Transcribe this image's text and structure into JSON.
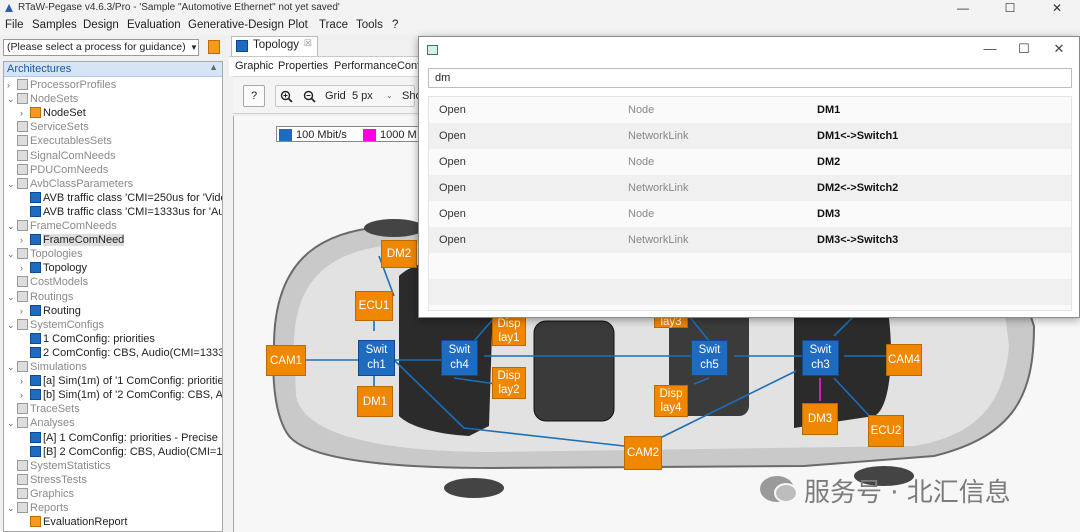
{
  "window": {
    "title": "RTaW-Pegase v4.6.3/Pro - 'Sample \"Automotive Ethernet\" not yet saved'",
    "controls": [
      "—",
      "☐",
      "✕"
    ]
  },
  "menu": [
    "File",
    "Samples",
    "Design",
    "Evaluation",
    "Generative-Design",
    "Plot",
    "Trace",
    "Tools",
    "?"
  ],
  "guidance": {
    "value": "(Please select a process for guidance)"
  },
  "tree": {
    "header": "Architectures",
    "header_ctl": "▲",
    "rows": [
      {
        "label": "ProcessorProfiles",
        "tw": "›",
        "ind": 0,
        "ic": "grey",
        "st": "grey"
      },
      {
        "label": "NodeSets",
        "tw": "⌄",
        "ind": 0,
        "ic": "grey",
        "st": "grey"
      },
      {
        "label": "NodeSet",
        "tw": "›",
        "ind": 1,
        "ic": "orange",
        "st": ""
      },
      {
        "label": "ServiceSets",
        "tw": "",
        "ind": 0,
        "ic": "grey",
        "st": "grey"
      },
      {
        "label": "ExecutablesSets",
        "tw": "",
        "ind": 0,
        "ic": "grey",
        "st": "grey"
      },
      {
        "label": "SignalComNeeds",
        "tw": "",
        "ind": 0,
        "ic": "grey",
        "st": "grey"
      },
      {
        "label": "PDUComNeeds",
        "tw": "",
        "ind": 0,
        "ic": "grey",
        "st": "grey"
      },
      {
        "label": "AvbClassParameters",
        "tw": "⌄",
        "ind": 0,
        "ic": "grey",
        "st": "grey"
      },
      {
        "label": "AVB traffic class 'CMI=250us for 'Vide",
        "tw": "",
        "ind": 1,
        "ic": "blue",
        "st": ""
      },
      {
        "label": "AVB traffic class 'CMI=1333us for 'Au",
        "tw": "",
        "ind": 1,
        "ic": "blue",
        "st": ""
      },
      {
        "label": "FrameComNeeds",
        "tw": "⌄",
        "ind": 0,
        "ic": "grey",
        "st": "grey"
      },
      {
        "label": "FrameComNeed",
        "tw": "›",
        "ind": 1,
        "ic": "blue",
        "st": "sel"
      },
      {
        "label": "Topologies",
        "tw": "⌄",
        "ind": 0,
        "ic": "grey",
        "st": "grey"
      },
      {
        "label": "Topology",
        "tw": "›",
        "ind": 1,
        "ic": "blue",
        "st": ""
      },
      {
        "label": "CostModels",
        "tw": "",
        "ind": 0,
        "ic": "grey",
        "st": "grey"
      },
      {
        "label": "Routings",
        "tw": "⌄",
        "ind": 0,
        "ic": "grey",
        "st": "grey"
      },
      {
        "label": "Routing",
        "tw": "›",
        "ind": 1,
        "ic": "blue",
        "st": ""
      },
      {
        "label": "SystemConfigs",
        "tw": "⌄",
        "ind": 0,
        "ic": "grey",
        "st": "grey"
      },
      {
        "label": "1 ComConfig: priorities",
        "tw": "",
        "ind": 1,
        "ic": "blue",
        "st": ""
      },
      {
        "label": "2 ComConfig: CBS, Audio(CMI=1333)",
        "tw": "",
        "ind": 1,
        "ic": "blue",
        "st": ""
      },
      {
        "label": "Simulations",
        "tw": "⌄",
        "ind": 0,
        "ic": "grey",
        "st": "grey"
      },
      {
        "label": "[a] Sim(1m) of '1 ComConfig: prioritie",
        "tw": "›",
        "ind": 1,
        "ic": "blue",
        "st": ""
      },
      {
        "label": "[b] Sim(1m) of '2 ComConfig: CBS, Au",
        "tw": "›",
        "ind": 1,
        "ic": "blue",
        "st": ""
      },
      {
        "label": "TraceSets",
        "tw": "",
        "ind": 0,
        "ic": "grey",
        "st": "grey"
      },
      {
        "label": "Analyses",
        "tw": "⌄",
        "ind": 0,
        "ic": "grey",
        "st": "grey"
      },
      {
        "label": "[A]  1 ComConfig: priorities - Precise",
        "tw": "",
        "ind": 1,
        "ic": "blue",
        "st": ""
      },
      {
        "label": "[B]  2 ComConfig: CBS, Audio(CMI=1",
        "tw": "",
        "ind": 1,
        "ic": "blue",
        "st": ""
      },
      {
        "label": "SystemStatistics",
        "tw": "",
        "ind": 0,
        "ic": "grey",
        "st": "grey"
      },
      {
        "label": "StressTests",
        "tw": "",
        "ind": 0,
        "ic": "grey",
        "st": "grey"
      },
      {
        "label": "Graphics",
        "tw": "",
        "ind": 0,
        "ic": "grey",
        "st": "grey"
      },
      {
        "label": "Reports",
        "tw": "⌄",
        "ind": 0,
        "ic": "grey",
        "st": "grey"
      },
      {
        "label": "EvaluationReport",
        "tw": "",
        "ind": 1,
        "ic": "orange",
        "st": ""
      }
    ]
  },
  "editor": {
    "tab": "Topology",
    "tab_close": "☒",
    "subtabs": [
      "Graphic",
      "Properties",
      "PerformanceConfi"
    ],
    "toolbar": {
      "help": "?",
      "grid_label": "Grid",
      "grid_value": "5 px",
      "show": "Sho"
    }
  },
  "legend": [
    {
      "label": "100  Mbit/s",
      "color": "#1e6bc0"
    },
    {
      "label": "1000  M",
      "color": "#ff00e0"
    }
  ],
  "colors": {
    "node": "#ef8700",
    "switch": "#1e6bc0",
    "link": "#1a6fb8",
    "gbit_link": "#e020c8"
  },
  "network": {
    "switches": [
      {
        "id": "s1",
        "label": "Swit\nch1"
      },
      {
        "id": "s4",
        "label": "Swit\nch4"
      },
      {
        "id": "s5",
        "label": "Swit\nch5"
      },
      {
        "id": "s3",
        "label": "Swit\nch3"
      }
    ],
    "nodes": [
      {
        "id": "dm2",
        "label": "DM2"
      },
      {
        "id": "ecu1",
        "label": "ECU1"
      },
      {
        "id": "cam1",
        "label": "CAM1"
      },
      {
        "id": "dm1",
        "label": "DM1"
      },
      {
        "id": "disp1",
        "label": "Disp\nlay1"
      },
      {
        "id": "disp2",
        "label": "Disp\nlay2"
      },
      {
        "id": "disp3",
        "label": "lay3"
      },
      {
        "id": "disp4",
        "label": "Disp\nlay4"
      },
      {
        "id": "cam2",
        "label": "CAM2"
      },
      {
        "id": "cam4",
        "label": "CAM4"
      },
      {
        "id": "dm3",
        "label": "DM3"
      },
      {
        "id": "ecu2",
        "label": "ECU2"
      }
    ]
  },
  "search_dialog": {
    "query": "dm",
    "results": [
      {
        "action": "Open",
        "type": "Node",
        "name": "DM1"
      },
      {
        "action": "Open",
        "type": "NetworkLink",
        "name": "DM1<->Switch1"
      },
      {
        "action": "Open",
        "type": "Node",
        "name": "DM2"
      },
      {
        "action": "Open",
        "type": "NetworkLink",
        "name": "DM2<->Switch2"
      },
      {
        "action": "Open",
        "type": "Node",
        "name": "DM3"
      },
      {
        "action": "Open",
        "type": "NetworkLink",
        "name": "DM3<->Switch3"
      }
    ]
  },
  "watermark": "服务号 · 北汇信息"
}
